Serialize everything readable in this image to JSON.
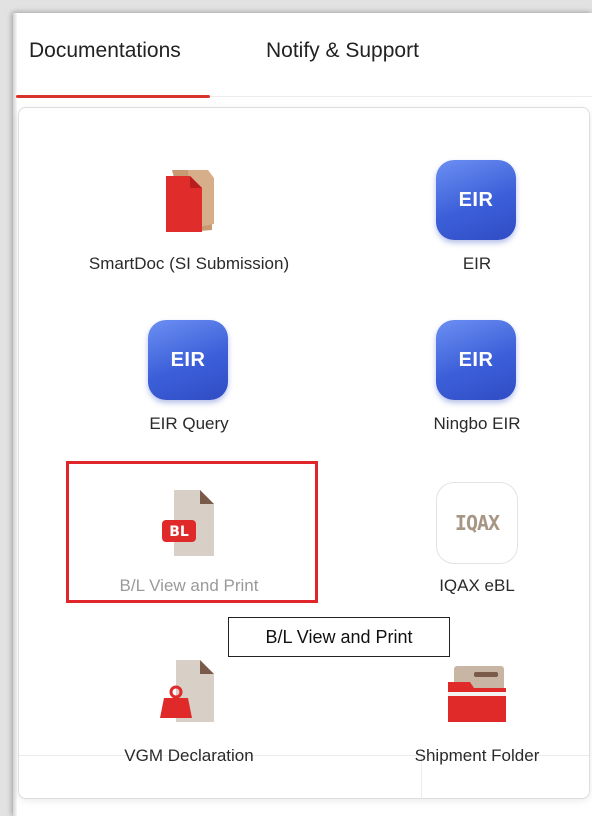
{
  "tabs": [
    {
      "label": "Documentations",
      "active": true
    },
    {
      "label": "Notify & Support",
      "active": false
    }
  ],
  "accent_color": "#d9342b",
  "apps": [
    {
      "label": "SmartDoc (SI Submission)",
      "icon": "smartdoc-icon"
    },
    {
      "label": "EIR",
      "icon": "eir-icon",
      "icon_text": "EIR"
    },
    {
      "label": "EIR Query",
      "icon": "eir-icon",
      "icon_text": "EIR"
    },
    {
      "label": "Ningbo EIR",
      "icon": "eir-icon",
      "icon_text": "EIR"
    },
    {
      "label": "B/L View and Print",
      "icon": "bl-document-icon",
      "icon_text": "BL",
      "hovered": true
    },
    {
      "label": "IQAX eBL",
      "icon": "iqax-logo-icon",
      "icon_text": "IQAX"
    },
    {
      "label": "VGM Declaration",
      "icon": "vgm-weight-icon"
    },
    {
      "label": "Shipment Folder",
      "icon": "folder-icon"
    }
  ],
  "tooltip": {
    "text": "B/L View and Print"
  },
  "highlight_color": "#e0262a"
}
